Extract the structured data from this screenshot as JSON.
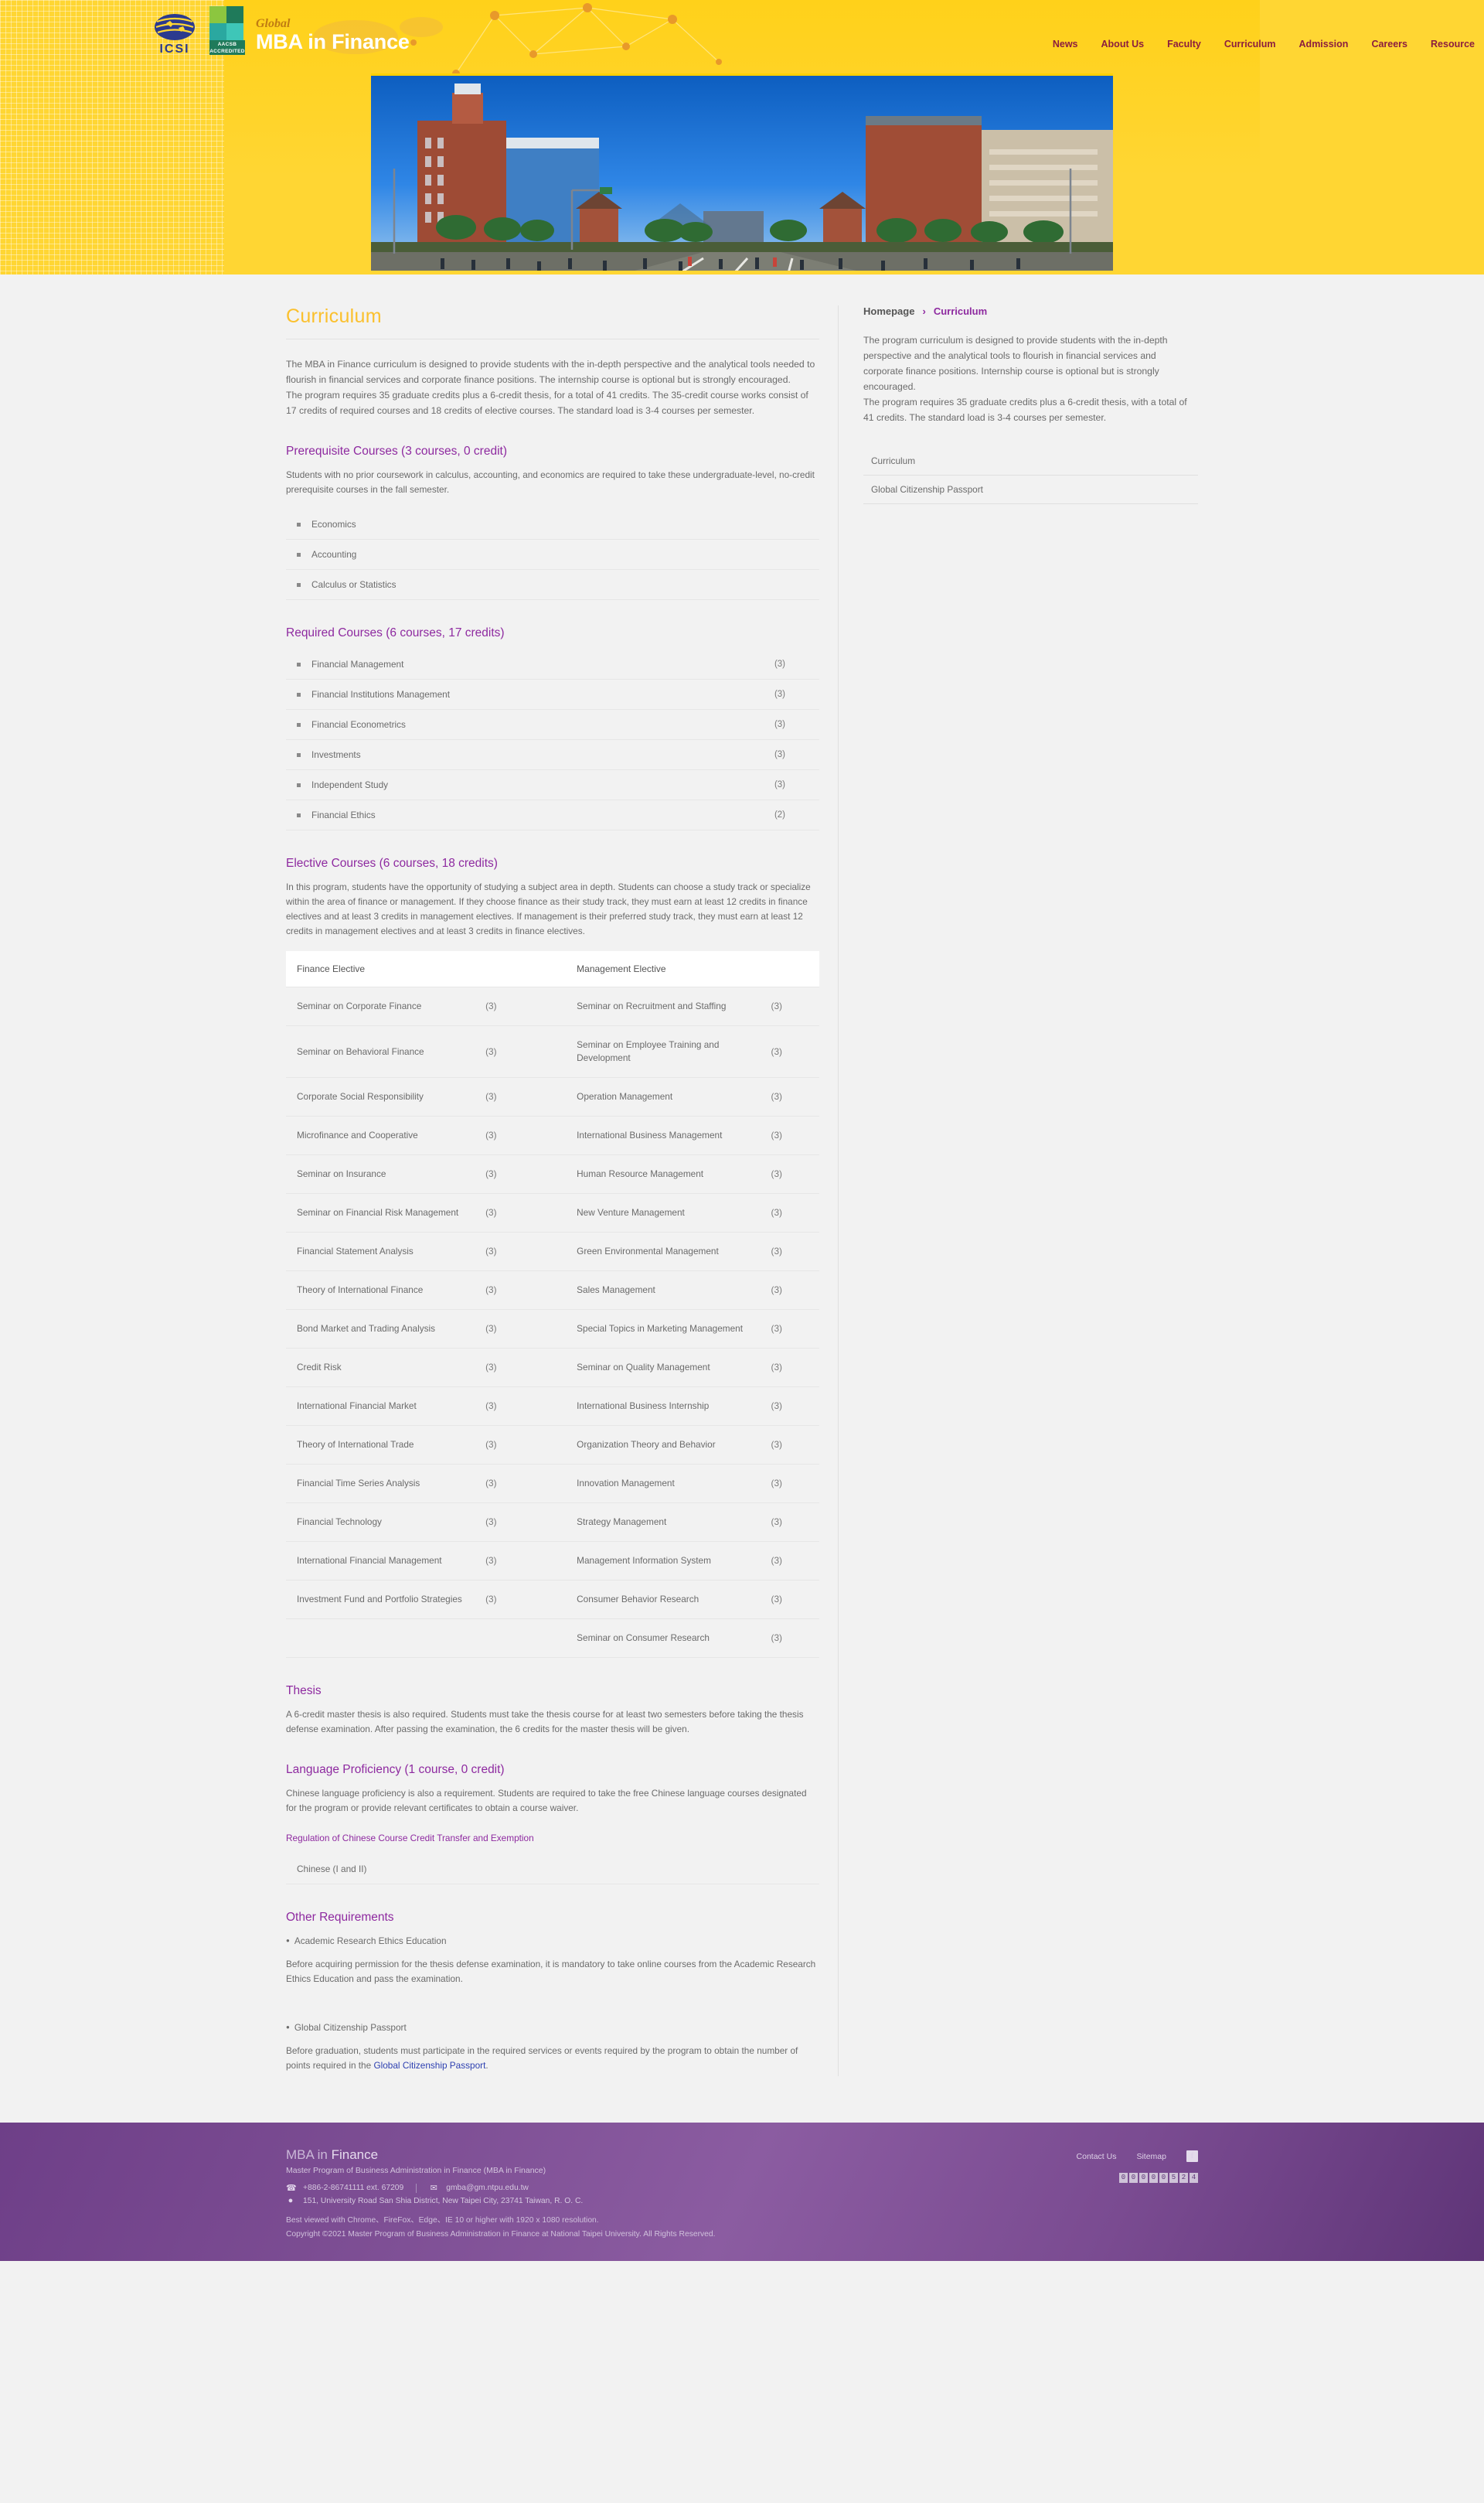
{
  "header": {
    "brand": {
      "icsi_label": "ICSI",
      "aacsb_label": "AACSB",
      "aacsb_sub": "ACCREDITED",
      "eyebrow": "Global",
      "title": "MBA in Finance"
    },
    "nav": [
      {
        "label": "News"
      },
      {
        "label": "About Us"
      },
      {
        "label": "Faculty"
      },
      {
        "label": "Curriculum"
      },
      {
        "label": "Admission"
      },
      {
        "label": "Careers"
      },
      {
        "label": "Resource"
      }
    ]
  },
  "main": {
    "page_title": "Curriculum",
    "intro_p1": "The MBA in Finance curriculum is designed to provide students with the in-depth perspective and the analytical tools needed to flourish in financial services and corporate finance positions. The internship course is optional but is strongly encouraged.",
    "intro_p2": "The program requires 35 graduate credits plus a 6-credit thesis, for a total of 41 credits. The 35-credit course works consist of 17 credits of required courses and 18 credits of elective courses. The standard load is 3-4 courses per semester.",
    "prerequisite": {
      "heading": "Prerequisite Courses (3 courses, 0 credit)",
      "description": "Students with no prior coursework in calculus, accounting, and economics are required to take these undergraduate-level, no-credit prerequisite courses in the fall semester.",
      "courses": [
        {
          "name": "Economics",
          "credits": ""
        },
        {
          "name": "Accounting",
          "credits": ""
        },
        {
          "name": "Calculus or Statistics",
          "credits": ""
        }
      ]
    },
    "required": {
      "heading": "Required Courses (6 courses, 17 credits)",
      "courses": [
        {
          "name": "Financial Management",
          "credits": "(3)"
        },
        {
          "name": "Financial Institutions Management",
          "credits": "(3)"
        },
        {
          "name": "Financial Econometrics",
          "credits": "(3)"
        },
        {
          "name": "Investments",
          "credits": "(3)"
        },
        {
          "name": "Independent Study",
          "credits": "(3)"
        },
        {
          "name": "Financial Ethics",
          "credits": "(2)"
        }
      ]
    },
    "elective": {
      "heading": "Elective Courses (6 courses, 18 credits)",
      "description": "In this program, students have the opportunity of studying a subject area in depth. Students can choose a study track or specialize within the area of finance or management. If they choose finance as their study track, they must earn at least 12 credits in finance electives and at least 3 credits in management electives. If management is their preferred study track, they must earn at least 12 credits in management electives and at least 3 credits in finance electives.",
      "columns": [
        "Finance Elective",
        "",
        "Management Elective",
        ""
      ],
      "rows": [
        [
          "Seminar on Corporate Finance",
          "(3)",
          "Seminar on Recruitment and Staffing",
          "(3)"
        ],
        [
          "Seminar on Behavioral Finance",
          "(3)",
          "Seminar on Employee Training and Development",
          "(3)"
        ],
        [
          "Corporate Social Responsibility",
          "(3)",
          "Operation Management",
          "(3)"
        ],
        [
          "Microfinance and Cooperative",
          "(3)",
          "International Business Management",
          "(3)"
        ],
        [
          "Seminar on Insurance",
          "(3)",
          "Human Resource Management",
          "(3)"
        ],
        [
          "Seminar on Financial Risk Management",
          "(3)",
          "New Venture Management",
          "(3)"
        ],
        [
          "Financial Statement Analysis",
          "(3)",
          "Green Environmental Management",
          "(3)"
        ],
        [
          "Theory of International Finance",
          "(3)",
          "Sales Management",
          "(3)"
        ],
        [
          "Bond Market and Trading Analysis",
          "(3)",
          "Special Topics in Marketing Management",
          "(3)"
        ],
        [
          "Credit Risk",
          "(3)",
          "Seminar on Quality Management",
          "(3)"
        ],
        [
          "International Financial Market",
          "(3)",
          "International Business Internship",
          "(3)"
        ],
        [
          "Theory of International Trade",
          "(3)",
          "Organization Theory and Behavior",
          "(3)"
        ],
        [
          "Financial Time Series Analysis",
          "(3)",
          "Innovation Management",
          "(3)"
        ],
        [
          "Financial Technology",
          "(3)",
          "Strategy Management",
          "(3)"
        ],
        [
          "International Financial Management",
          "(3)",
          "Management Information System",
          "(3)"
        ],
        [
          "Investment Fund and Portfolio Strategies",
          "(3)",
          "Consumer Behavior Research",
          "(3)"
        ],
        [
          "",
          "",
          "Seminar on Consumer Research",
          "(3)"
        ]
      ]
    },
    "thesis": {
      "heading": "Thesis",
      "description": "A 6-credit master thesis is also required. Students must take the thesis course for at least two semesters before taking the thesis defense examination. After passing the examination, the 6 credits for the master thesis will be given."
    },
    "language": {
      "heading": "Language Proficiency (1 course, 0 credit)",
      "description": "Chinese language proficiency is also a requirement. Students are required to take the free Chinese language courses designated for the program or provide relevant certificates to obtain a course waiver.",
      "link": "Regulation of Chinese Course Credit Transfer and Exemption",
      "courses": [
        "Chinese (I and II)"
      ]
    },
    "other": {
      "heading": "Other Requirements",
      "items": [
        {
          "title": "Academic Research Ethics Education",
          "body_before": "Before acquiring permission for the thesis defense examination, it is mandatory to take online courses from the Academic Research Ethics Education and pass the examination.",
          "link": "",
          "body_after": ""
        },
        {
          "title": "Global Citizenship Passport",
          "body_before": "Before graduation, students must participate in the required services or events required by the program to obtain the number of points required in the ",
          "link": "Global Citizenship Passport",
          "body_after": "."
        }
      ]
    }
  },
  "sidebar": {
    "breadcrumb_home": "Homepage",
    "breadcrumb_sep": "›",
    "breadcrumb_current": "Curriculum",
    "summary_p1": "The program curriculum is designed to provide students with the in-depth perspective and the analytical tools to flourish in financial services and corporate finance positions. Internship course is optional but is strongly encouraged.",
    "summary_p2": "The program requires 35 graduate credits plus a 6-credit thesis, with a total of 41 credits. The standard load is 3-4 courses per semester.",
    "menu": [
      {
        "label": "Curriculum"
      },
      {
        "label": "Global Citizenship Passport"
      }
    ]
  },
  "footer": {
    "brand_prefix": "MBA",
    "brand_mid": " in ",
    "brand_suffix": "Finance",
    "subtitle": "Master Program of Business Administration in Finance (MBA in Finance)",
    "phone": "+886-2-86741111 ext. 67209",
    "email": "gmba@gm.ntpu.edu.tw",
    "address": "151, University Road San Shia District, New Taipei City, 23741 Taiwan, R. O. C.",
    "best_viewed": "Best viewed with Chrome、FireFox、Edge、IE 10 or higher with 1920 x 1080 resolution.",
    "copyright": "Copyright ©2021 Master Program of Business Administration in Finance at National Taipei University. All Rights Reserved.",
    "links": [
      {
        "label": "Contact Us"
      },
      {
        "label": "Sitemap"
      }
    ],
    "facebook_glyph": "f",
    "counter": [
      "0",
      "0",
      "0",
      "0",
      "0",
      "5",
      "2",
      "4"
    ]
  }
}
